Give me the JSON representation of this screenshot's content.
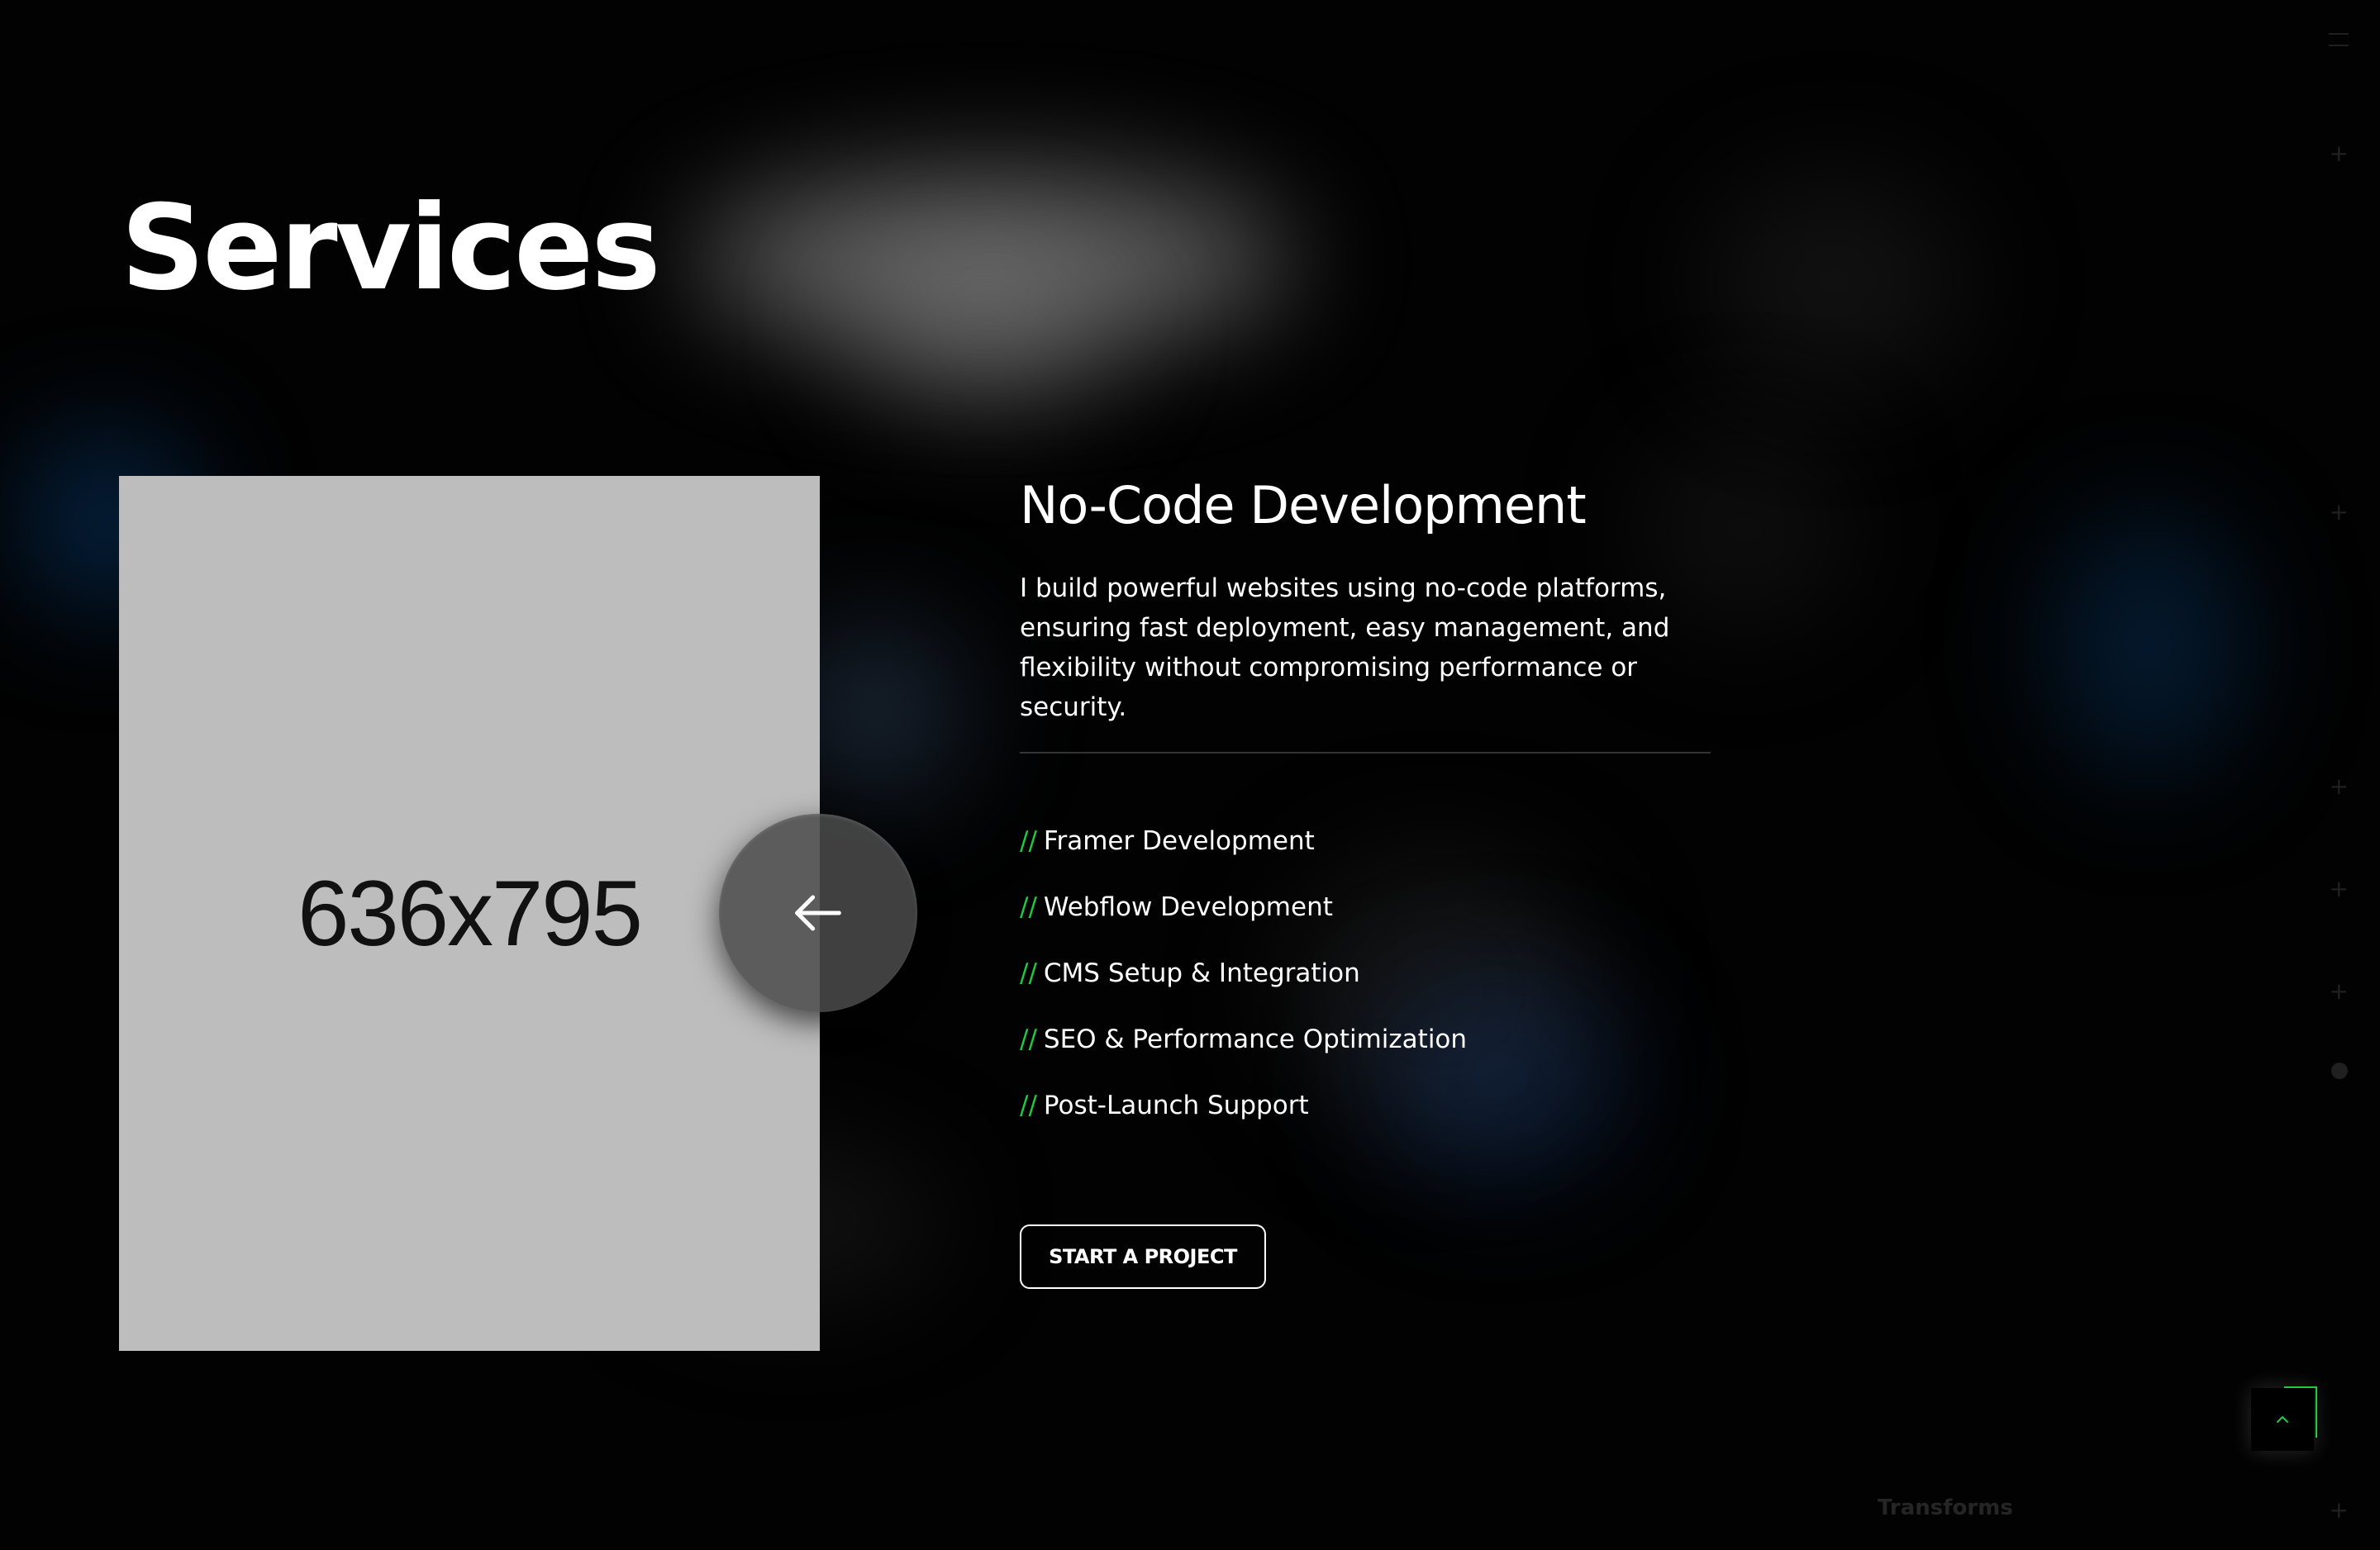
{
  "section": {
    "title": "Services"
  },
  "image": {
    "placeholder_text": "636x795"
  },
  "carousel": {
    "prev_icon": "arrow-left-icon"
  },
  "service": {
    "title": "No-Code Development",
    "description": "I build powerful websites using no-code platforms, ensuring fast deployment, easy management, and flexibility without compromising performance or security.",
    "feature_prefix": "//",
    "features": [
      "Framer Development",
      "Webflow Development",
      "CMS Setup & Integration",
      "SEO & Performance Optimization",
      "Post-Launch Support"
    ],
    "cta_label": "START A PROJECT"
  },
  "scroll_top": {
    "icon": "chevron-up-icon"
  },
  "background_ui": {
    "label": "Transforms",
    "plus_icon": "+",
    "menu_icon": "menu-icon",
    "dot_icon": "circle-icon"
  },
  "colors": {
    "background": "#020202",
    "accent_green": "#20c93d",
    "image_placeholder": "#bdbdbd",
    "text": "#ffffff"
  }
}
